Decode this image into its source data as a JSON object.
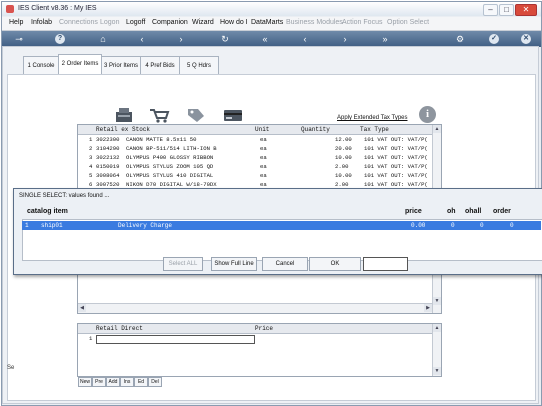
{
  "window": {
    "title": "IES Client v8.36 : My IES",
    "minimize": "–",
    "maximize": "□",
    "close": "✕"
  },
  "menu": [
    {
      "label": "Help",
      "disabled": false
    },
    {
      "label": "Infolab",
      "disabled": false
    },
    {
      "label": "Connections",
      "disabled": true
    },
    {
      "label": "Logon",
      "disabled": true
    },
    {
      "label": "Logoff",
      "disabled": false
    },
    {
      "label": "Companion",
      "disabled": false
    },
    {
      "label": "Wizard",
      "disabled": false
    },
    {
      "label": "How do I",
      "disabled": false
    },
    {
      "label": "DataMarts",
      "disabled": false
    },
    {
      "label": "Business Modules",
      "disabled": true
    },
    {
      "label": "Action Focus",
      "disabled": true
    },
    {
      "label": "Option Select",
      "disabled": true
    }
  ],
  "tabs": [
    {
      "label": "1 Console"
    },
    {
      "label": "2 Order Items"
    },
    {
      "label": "3 Prior Items"
    },
    {
      "label": "4 Pref Bids"
    },
    {
      "label": "5 Q Hdrs"
    }
  ],
  "toolbar": {
    "apply_tax_link": "Apply Extended Tax Types",
    "info_icon": "i"
  },
  "items_grid": {
    "headers": {
      "stock": "Retail ex Stock",
      "unit": "Unit",
      "quantity": "Quantity",
      "tax": "Tax Type"
    },
    "rows": [
      {
        "num": "1",
        "code": "3022300",
        "desc": "CANON MATTE 8.5x11 50",
        "unit": "ea",
        "qty": "12.00",
        "tax": "101 VAT OUT: VAT/P("
      },
      {
        "num": "2",
        "code": "3104290",
        "desc": "CANON BP-511/514 LITH-ION B",
        "unit": "ea",
        "qty": "20.00",
        "tax": "101 VAT OUT: VAT/P("
      },
      {
        "num": "3",
        "code": "3022132",
        "desc": "OLYMPUS P400 GLOSSY RIBBON",
        "unit": "ea",
        "qty": "10.00",
        "tax": "101 VAT OUT: VAT/P("
      },
      {
        "num": "4",
        "code": "0150019",
        "desc": "OLYMPUS STYLUS ZOOM 105 QD",
        "unit": "ea",
        "qty": "2.00",
        "tax": "101 VAT OUT: VAT/P("
      },
      {
        "num": "5",
        "code": "3008064",
        "desc": "OLYMPUS STYLUS 410 DIGITAL",
        "unit": "ea",
        "qty": "10.00",
        "tax": "101 VAT OUT: VAT/P("
      },
      {
        "num": "6",
        "code": "3007520",
        "desc": "NIKON D70 DIGITAL W/18-70DX",
        "unit": "ea",
        "qty": "2.00",
        "tax": "101 VAT OUT: VAT/P("
      }
    ]
  },
  "direct_grid": {
    "headers": {
      "desc": "Retail Direct",
      "price": "Price"
    },
    "rows": [
      {
        "num": "1",
        "desc": "",
        "price": ""
      }
    ]
  },
  "small_buttons": [
    "New",
    "Pre",
    "Add",
    "Ins",
    "Ed",
    "Del"
  ],
  "side_text": "Se",
  "dialog": {
    "title": "SINGLE SELECT: values found ...",
    "headers": {
      "item": "catalog item",
      "price": "price",
      "oh": "oh",
      "ohall": "ohall",
      "order": "order"
    },
    "rows": [
      {
        "num": "1",
        "code": "ship01",
        "desc": "Delivery Charge",
        "price": "0.00",
        "oh": "0",
        "ohall": "0",
        "order": "0"
      }
    ],
    "buttons": {
      "select_all": "Select ALL",
      "show_full_line": "Show Full Line",
      "cancel": "Cancel",
      "ok": "OK"
    },
    "search_value": ""
  }
}
